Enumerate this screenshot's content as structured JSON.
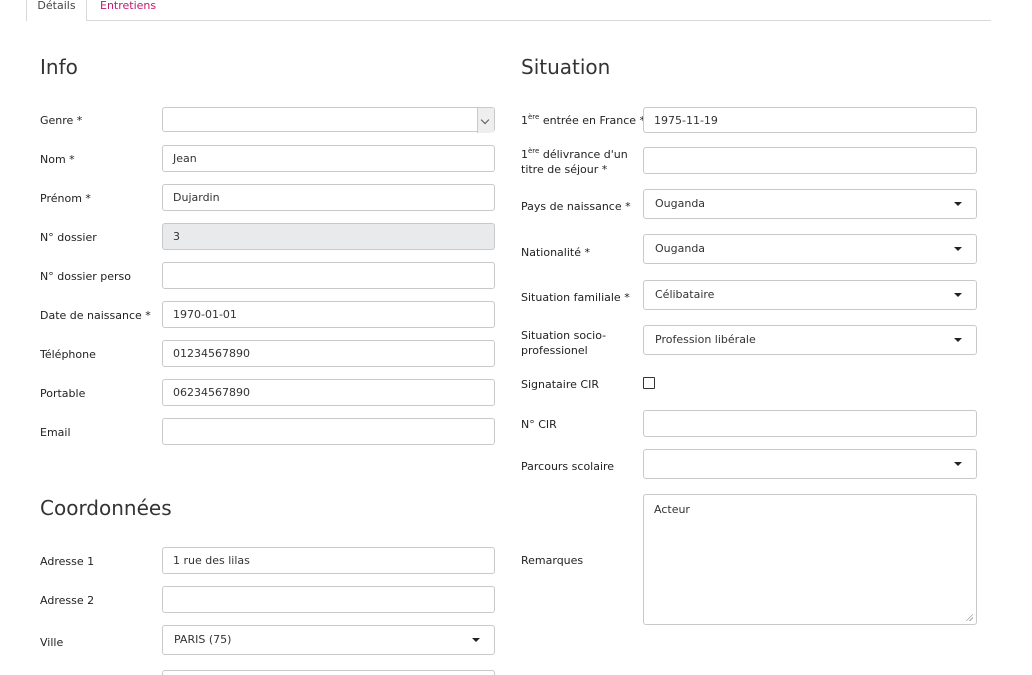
{
  "tabs": [
    {
      "label": "Détails",
      "active": true
    },
    {
      "label": "Entretiens",
      "active": false
    }
  ],
  "colors": {
    "link": "#c2186c",
    "border": "#c9c9c9",
    "disabled_bg": "#e8eaec"
  },
  "info": {
    "title": "Info",
    "genre": {
      "label": "Genre *",
      "value": ""
    },
    "nom": {
      "label": "Nom *",
      "value": "Jean"
    },
    "prenom": {
      "label": "Prénom *",
      "value": "Dujardin"
    },
    "dossier": {
      "label": "N° dossier",
      "value": "3"
    },
    "dossier_perso": {
      "label": "N° dossier perso",
      "value": ""
    },
    "naissance": {
      "label": "Date de naissance *",
      "value": "1970-01-01"
    },
    "telephone": {
      "label": "Téléphone",
      "value": "01234567890"
    },
    "portable": {
      "label": "Portable",
      "value": "06234567890"
    },
    "email": {
      "label": "Email",
      "value": ""
    }
  },
  "coordonnees": {
    "title": "Coordonnées",
    "adresse1": {
      "label": "Adresse 1",
      "value": "1 rue des lilas"
    },
    "adresse2": {
      "label": "Adresse 2",
      "value": ""
    },
    "ville": {
      "label": "Ville",
      "value": "PARIS (75)"
    }
  },
  "situation": {
    "title": "Situation",
    "entree": {
      "label_prefix": "1",
      "label_sup": "ère",
      "label_rest": " entrée en France *",
      "value": "1975-11-19"
    },
    "delivrance": {
      "label_prefix": "1",
      "label_sup": "ère",
      "label_rest1": " délivrance d'un",
      "label_line2": "titre de séjour *",
      "value": ""
    },
    "pays": {
      "label": "Pays de naissance *",
      "value": "Ouganda"
    },
    "nationalite": {
      "label": "Nationalité *",
      "value": "Ouganda"
    },
    "familiale": {
      "label": "Situation familiale *",
      "value": "Célibataire"
    },
    "socio": {
      "label_line1": "Situation socio-",
      "label_line2": "professionel",
      "value": "Profession libérale"
    },
    "cir": {
      "label": "Signataire CIR",
      "checked": false
    },
    "num_cir": {
      "label": "N° CIR",
      "value": ""
    },
    "parcours": {
      "label": "Parcours scolaire",
      "value": ""
    },
    "remarques": {
      "label": "Remarques",
      "value": "Acteur"
    }
  }
}
